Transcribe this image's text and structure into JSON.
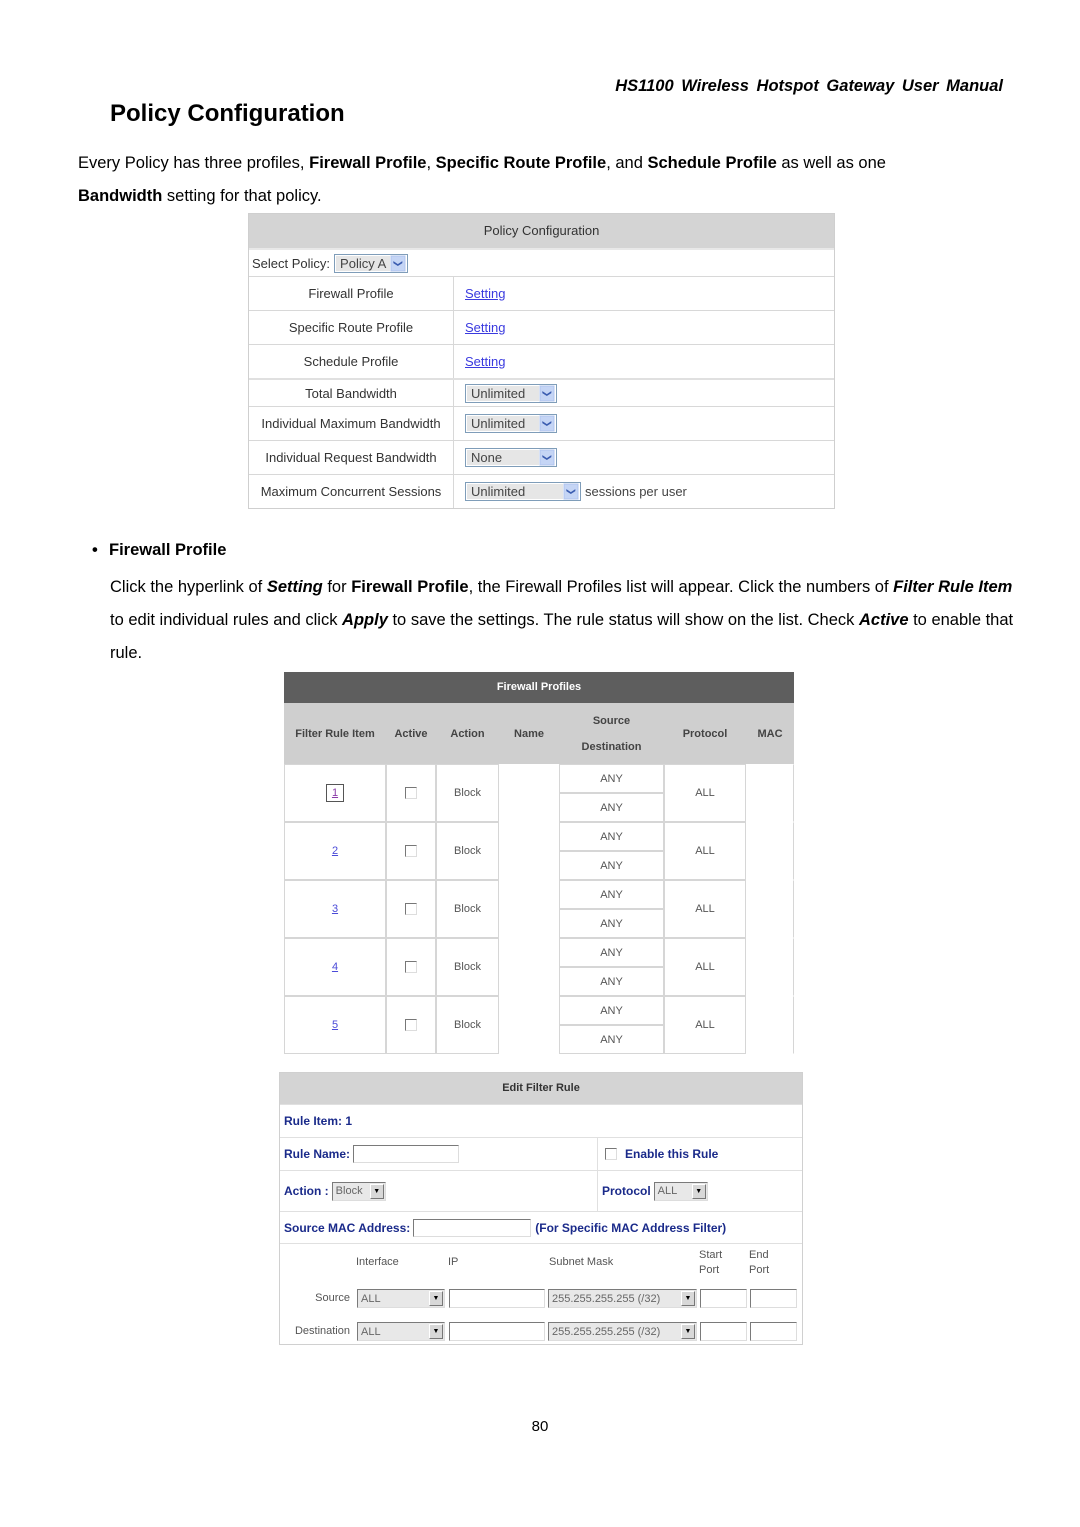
{
  "header": {
    "manual_title": "HS1100 Wireless Hotspot Gateway User Manual"
  },
  "page_heading": "Policy Configuration",
  "intro": {
    "p1": "Every Policy has three profiles, ",
    "b1": "Firewall Profile",
    "p2": ", ",
    "b2": "Specific Route Profile",
    "p3": ", and ",
    "b3": "Schedule Profile",
    "p4": " as well as one ",
    "b4": "Bandwidth",
    "p5": " setting for that policy."
  },
  "policy_config": {
    "title": "Policy Configuration",
    "select_policy_label": "Select Policy:",
    "select_policy_value": "Policy A",
    "rows": [
      {
        "label": "Firewall Profile",
        "link": "Setting"
      },
      {
        "label": "Specific Route Profile",
        "link": "Setting"
      },
      {
        "label": "Schedule Profile",
        "link": "Setting"
      },
      {
        "label": "Total Bandwidth",
        "select": "Unlimited"
      },
      {
        "label": "Individual Maximum Bandwidth",
        "select": "Unlimited"
      },
      {
        "label": "Individual Request Bandwidth",
        "select": "None"
      },
      {
        "label": "Maximum Concurrent Sessions",
        "select": "Unlimited",
        "suffix": "sessions per user"
      }
    ]
  },
  "firewall_section": {
    "bullet": "•",
    "heading": "Firewall Profile",
    "t1": "Click the hyperlink of ",
    "i1": "Setting",
    "t2": " for ",
    "b1": "Firewall Profile",
    "t3": ", the Firewall Profiles list will appear. Click the numbers of ",
    "i2": "Filter Rule Item",
    "t4": " to edit individual rules and click ",
    "i3": "Apply",
    "t5": " to save the settings. The rule status will show on the list. Check ",
    "i4": "Active",
    "t6": " to enable that rule."
  },
  "firewall_profiles": {
    "title": "Firewall Profiles",
    "columns": {
      "filter_rule_item": "Filter Rule Item",
      "active": "Active",
      "action": "Action",
      "name": "Name",
      "source": "Source",
      "destination": "Destination",
      "protocol": "Protocol",
      "mac": "MAC"
    },
    "rows": [
      {
        "item": "1",
        "active": false,
        "action": "Block",
        "name": "",
        "source": "ANY",
        "destination": "ANY",
        "protocol": "ALL",
        "mac": ""
      },
      {
        "item": "2",
        "active": false,
        "action": "Block",
        "name": "",
        "source": "ANY",
        "destination": "ANY",
        "protocol": "ALL",
        "mac": ""
      },
      {
        "item": "3",
        "active": false,
        "action": "Block",
        "name": "",
        "source": "ANY",
        "destination": "ANY",
        "protocol": "ALL",
        "mac": ""
      },
      {
        "item": "4",
        "active": false,
        "action": "Block",
        "name": "",
        "source": "ANY",
        "destination": "ANY",
        "protocol": "ALL",
        "mac": ""
      },
      {
        "item": "5",
        "active": false,
        "action": "Block",
        "name": "",
        "source": "ANY",
        "destination": "ANY",
        "protocol": "ALL",
        "mac": ""
      }
    ]
  },
  "edit_filter_rule": {
    "title": "Edit Filter Rule",
    "rule_item_label": "Rule Item: 1",
    "rule_name_label": "Rule Name:",
    "rule_name_value": "",
    "enable_label": "Enable this Rule",
    "enable_checked": false,
    "action_label": "Action :",
    "action_value": "Block",
    "protocol_label": "Protocol",
    "protocol_value": "ALL",
    "source_mac_label": "Source MAC Address:",
    "source_mac_value": "",
    "source_mac_hint": "(For Specific MAC Address Filter)",
    "grid_headers": {
      "interface": "Interface",
      "ip": "IP",
      "subnet_mask": "Subnet Mask",
      "start_port": "Start Port",
      "end_port": "End Port"
    },
    "grid_rows": [
      {
        "label": "Source",
        "interface": "ALL",
        "ip": "",
        "subnet_mask": "255.255.255.255 (/32)",
        "start_port": "",
        "end_port": ""
      },
      {
        "label": "Destination",
        "interface": "ALL",
        "ip": "",
        "subnet_mask": "255.255.255.255 (/32)",
        "start_port": "",
        "end_port": ""
      }
    ]
  },
  "footer": {
    "page_number": "80"
  }
}
